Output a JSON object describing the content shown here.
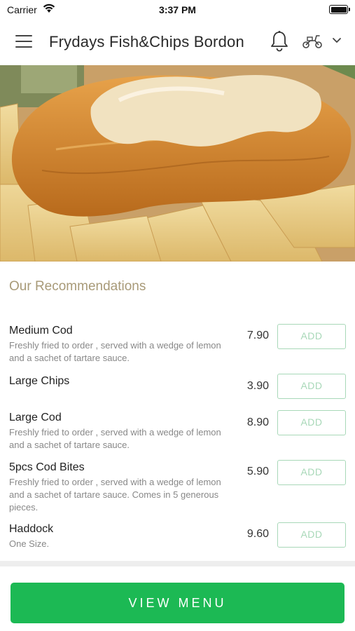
{
  "status": {
    "carrier": "Carrier",
    "time": "3:37 PM"
  },
  "header": {
    "title": "Frydays Fish&Chips Bordon"
  },
  "recommendations": {
    "title": "Our Recommendations",
    "items": [
      {
        "name": "Medium Cod",
        "desc": "Freshly fried to order , served with a wedge of lemon and a sachet of tartare sauce.",
        "price": "7.90",
        "add_label": "ADD"
      },
      {
        "name": "Large Chips",
        "desc": "",
        "price": "3.90",
        "add_label": "ADD"
      },
      {
        "name": "Large Cod",
        "desc": "Freshly fried to order , served with a wedge of lemon and a sachet of tartare sauce.",
        "price": "8.90",
        "add_label": "ADD"
      },
      {
        "name": "5pcs Cod Bites",
        "desc": "Freshly fried to order , served with a wedge of lemon and a sachet of tartare sauce. Comes in 5 generous pieces.",
        "price": "5.90",
        "add_label": "ADD"
      },
      {
        "name": "Haddock",
        "desc": "One Size.",
        "price": "9.60",
        "add_label": "ADD"
      }
    ]
  },
  "footer": {
    "view_menu_label": "VIEW MENU"
  },
  "colors": {
    "accent_green": "#1cb954",
    "add_border": "#a8d8b8",
    "section_title": "#a89a78"
  },
  "icons": [
    "wifi-icon",
    "battery-icon",
    "menu-icon",
    "bell-icon",
    "scooter-icon",
    "chevron-down-icon"
  ]
}
